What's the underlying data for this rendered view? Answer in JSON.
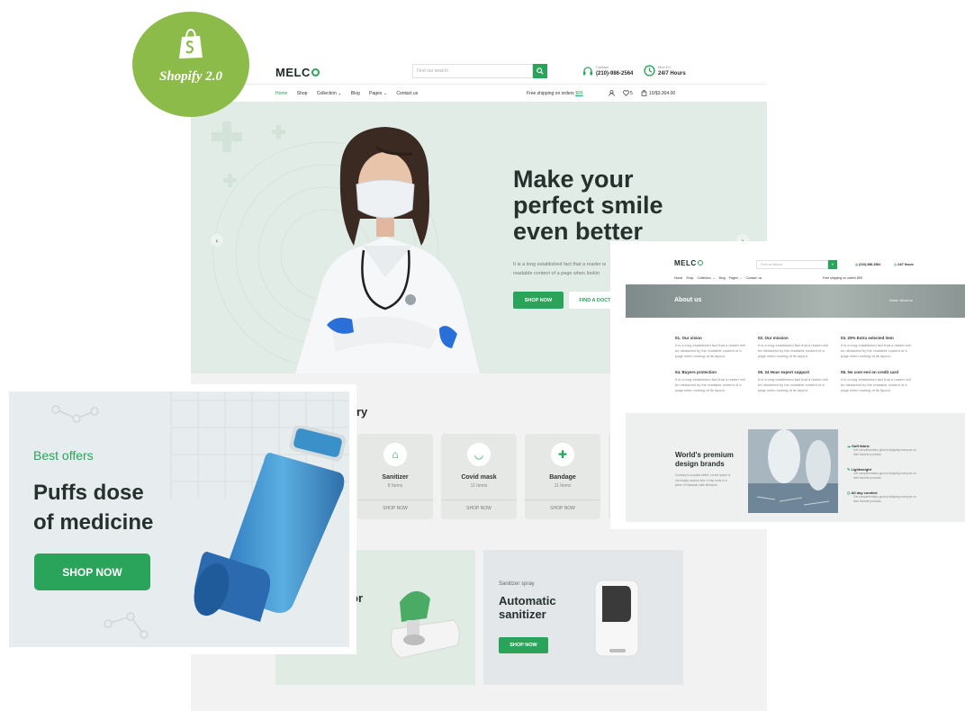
{
  "badge": {
    "label": "Shopify 2.0",
    "icon": "shopify-bag-icon"
  },
  "header": {
    "logo": "MELC",
    "search_placeholder": "Find our search",
    "contact_label": "Contact",
    "contact_phone": "(210)-986-2564",
    "hours_label": "Mon-Fri",
    "hours_value": "24/7 Hours",
    "nav": [
      "Home",
      "Shop",
      "Collection ⌄",
      "Blog",
      "Pages ⌄",
      "Contact us"
    ],
    "free_shipping": "Free shipping on orders",
    "free_shipping_amount": "$99",
    "wishlist_count": "5",
    "cart": "10/$3.304.00"
  },
  "hero": {
    "title_line1": "Make your",
    "title_line2": "perfect smile",
    "title_line3": "even better",
    "body_line1": "It is a long established fact that a reader w",
    "body_line2": "readable content of a page when lookin",
    "btn_primary": "SHOP NOW",
    "btn_secondary": "FIND A DOCTOR"
  },
  "category": {
    "heading_fragment": "ory",
    "items": [
      {
        "name": "Sanitizer",
        "count": "8 Items",
        "link": "SHOP NOW",
        "icon": "sanitizer-bottle-icon"
      },
      {
        "name": "Covid mask",
        "count": "11 Items",
        "link": "SHOP NOW",
        "icon": "mask-icon"
      },
      {
        "name": "Bandage",
        "count": "11 Items",
        "link": "SHOP NOW",
        "icon": "bandage-icon"
      }
    ]
  },
  "promo_left": {
    "title_fragment": "or"
  },
  "promo_right": {
    "kicker": "Sanitizer spray",
    "title_line1": "Automatic",
    "title_line2": "sanitizer",
    "btn": "SHOP NOW"
  },
  "offer": {
    "kicker": "Best offers",
    "title_line1": "Puffs dose",
    "title_line2": "of medicine",
    "btn": "SHOP NOW"
  },
  "about": {
    "logo": "MELC",
    "search_placeholder": "Find our search",
    "phone": "(210)-986-2564",
    "hours": "24/7 Hours",
    "nav": [
      "Home",
      "Shop",
      "Collection ⌄",
      "Blog",
      "Pages ⌄",
      "Contact us"
    ],
    "shipping": "Free shipping on orders $99",
    "banner_title": "About us",
    "breadcrumb": "Home / About us",
    "features": [
      {
        "title": "01. Our vision",
        "text": "It is a long established fact that a reader will be distracted by the readable content of a page when looking at its layout."
      },
      {
        "title": "02. Our mission",
        "text": "It is a long established fact that a reader will be distracted by the readable content of a page when looking at its layout."
      },
      {
        "title": "03. 20% Extra selected item",
        "text": "It is a long established fact that a reader will be distracted by the readable content of a page when looking at its layout."
      },
      {
        "title": "04. Buyers protection",
        "text": "It is a long established fact that a reader will be distracted by the readable content of a page when looking at its layout."
      },
      {
        "title": "05. 24 Hour expert support",
        "text": "It is a long established fact that a reader will be distracted by the readable content of a page when looking at its layout."
      },
      {
        "title": "06. No cost emi on credit card",
        "text": "It is a long established fact that a reader will be distracted by the readable content of a page when looking at its layout."
      }
    ],
    "brands_title_line1": "World's premium",
    "brands_title_line2": "design brands",
    "brands_text": "Contrary to popular belief, Lorem Ipsum is not simply random text. It has roots in a piece of classical Latin literature.",
    "brands_points": [
      {
        "title": "Soft fabric",
        "text": "Get complementary ground shipping everyone on their favorite products."
      },
      {
        "title": "Lightweight",
        "text": "Get complementary ground shipping everyone on their favorite products."
      },
      {
        "title": "All day comfort",
        "text": "Get complementary ground shipping everyone on their favorite products."
      }
    ]
  },
  "colors": {
    "accent": "#2aa45b",
    "badge": "#8dbb4a",
    "hero_bg": "#e2ece7"
  }
}
